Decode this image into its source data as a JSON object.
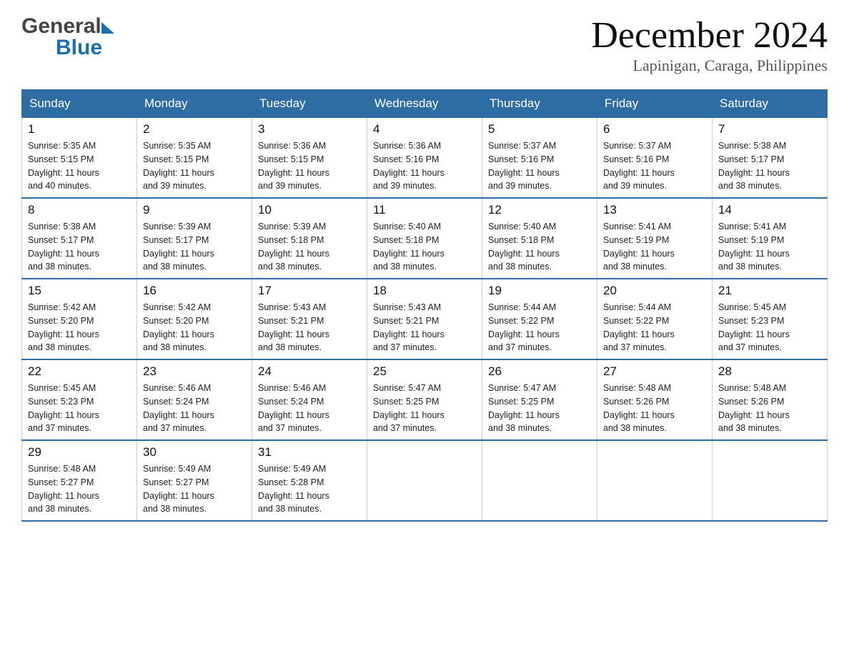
{
  "header": {
    "month_title": "December 2024",
    "location": "Lapinigan, Caraga, Philippines",
    "logo_general": "General",
    "logo_blue": "Blue"
  },
  "days_of_week": [
    "Sunday",
    "Monday",
    "Tuesday",
    "Wednesday",
    "Thursday",
    "Friday",
    "Saturday"
  ],
  "weeks": [
    {
      "days": [
        {
          "num": "1",
          "sunrise": "5:35 AM",
          "sunset": "5:15 PM",
          "daylight": "11 hours and 40 minutes."
        },
        {
          "num": "2",
          "sunrise": "5:35 AM",
          "sunset": "5:15 PM",
          "daylight": "11 hours and 39 minutes."
        },
        {
          "num": "3",
          "sunrise": "5:36 AM",
          "sunset": "5:15 PM",
          "daylight": "11 hours and 39 minutes."
        },
        {
          "num": "4",
          "sunrise": "5:36 AM",
          "sunset": "5:16 PM",
          "daylight": "11 hours and 39 minutes."
        },
        {
          "num": "5",
          "sunrise": "5:37 AM",
          "sunset": "5:16 PM",
          "daylight": "11 hours and 39 minutes."
        },
        {
          "num": "6",
          "sunrise": "5:37 AM",
          "sunset": "5:16 PM",
          "daylight": "11 hours and 39 minutes."
        },
        {
          "num": "7",
          "sunrise": "5:38 AM",
          "sunset": "5:17 PM",
          "daylight": "11 hours and 38 minutes."
        }
      ]
    },
    {
      "days": [
        {
          "num": "8",
          "sunrise": "5:38 AM",
          "sunset": "5:17 PM",
          "daylight": "11 hours and 38 minutes."
        },
        {
          "num": "9",
          "sunrise": "5:39 AM",
          "sunset": "5:17 PM",
          "daylight": "11 hours and 38 minutes."
        },
        {
          "num": "10",
          "sunrise": "5:39 AM",
          "sunset": "5:18 PM",
          "daylight": "11 hours and 38 minutes."
        },
        {
          "num": "11",
          "sunrise": "5:40 AM",
          "sunset": "5:18 PM",
          "daylight": "11 hours and 38 minutes."
        },
        {
          "num": "12",
          "sunrise": "5:40 AM",
          "sunset": "5:18 PM",
          "daylight": "11 hours and 38 minutes."
        },
        {
          "num": "13",
          "sunrise": "5:41 AM",
          "sunset": "5:19 PM",
          "daylight": "11 hours and 38 minutes."
        },
        {
          "num": "14",
          "sunrise": "5:41 AM",
          "sunset": "5:19 PM",
          "daylight": "11 hours and 38 minutes."
        }
      ]
    },
    {
      "days": [
        {
          "num": "15",
          "sunrise": "5:42 AM",
          "sunset": "5:20 PM",
          "daylight": "11 hours and 38 minutes."
        },
        {
          "num": "16",
          "sunrise": "5:42 AM",
          "sunset": "5:20 PM",
          "daylight": "11 hours and 38 minutes."
        },
        {
          "num": "17",
          "sunrise": "5:43 AM",
          "sunset": "5:21 PM",
          "daylight": "11 hours and 38 minutes."
        },
        {
          "num": "18",
          "sunrise": "5:43 AM",
          "sunset": "5:21 PM",
          "daylight": "11 hours and 37 minutes."
        },
        {
          "num": "19",
          "sunrise": "5:44 AM",
          "sunset": "5:22 PM",
          "daylight": "11 hours and 37 minutes."
        },
        {
          "num": "20",
          "sunrise": "5:44 AM",
          "sunset": "5:22 PM",
          "daylight": "11 hours and 37 minutes."
        },
        {
          "num": "21",
          "sunrise": "5:45 AM",
          "sunset": "5:23 PM",
          "daylight": "11 hours and 37 minutes."
        }
      ]
    },
    {
      "days": [
        {
          "num": "22",
          "sunrise": "5:45 AM",
          "sunset": "5:23 PM",
          "daylight": "11 hours and 37 minutes."
        },
        {
          "num": "23",
          "sunrise": "5:46 AM",
          "sunset": "5:24 PM",
          "daylight": "11 hours and 37 minutes."
        },
        {
          "num": "24",
          "sunrise": "5:46 AM",
          "sunset": "5:24 PM",
          "daylight": "11 hours and 37 minutes."
        },
        {
          "num": "25",
          "sunrise": "5:47 AM",
          "sunset": "5:25 PM",
          "daylight": "11 hours and 37 minutes."
        },
        {
          "num": "26",
          "sunrise": "5:47 AM",
          "sunset": "5:25 PM",
          "daylight": "11 hours and 38 minutes."
        },
        {
          "num": "27",
          "sunrise": "5:48 AM",
          "sunset": "5:26 PM",
          "daylight": "11 hours and 38 minutes."
        },
        {
          "num": "28",
          "sunrise": "5:48 AM",
          "sunset": "5:26 PM",
          "daylight": "11 hours and 38 minutes."
        }
      ]
    },
    {
      "days": [
        {
          "num": "29",
          "sunrise": "5:48 AM",
          "sunset": "5:27 PM",
          "daylight": "11 hours and 38 minutes."
        },
        {
          "num": "30",
          "sunrise": "5:49 AM",
          "sunset": "5:27 PM",
          "daylight": "11 hours and 38 minutes."
        },
        {
          "num": "31",
          "sunrise": "5:49 AM",
          "sunset": "5:28 PM",
          "daylight": "11 hours and 38 minutes."
        },
        null,
        null,
        null,
        null
      ]
    }
  ],
  "labels": {
    "sunrise": "Sunrise:",
    "sunset": "Sunset:",
    "daylight": "Daylight:"
  }
}
